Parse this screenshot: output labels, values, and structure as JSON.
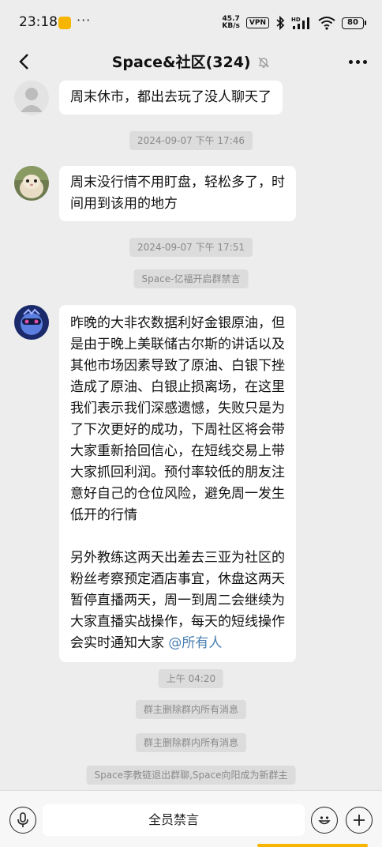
{
  "status_bar": {
    "time": "23:18",
    "dots": "···",
    "net_speed_value": "45.7",
    "net_speed_unit": "KB/s",
    "vpn": "VPN",
    "battery": "80"
  },
  "header": {
    "title": "Space&社区(324)"
  },
  "messages": [
    {
      "kind": "text",
      "avatar": "gray-default",
      "lines": [
        "周末休市，都出去玩了没人聊天了"
      ]
    },
    {
      "kind": "system",
      "text": "2024-09-07 下午 17:46"
    },
    {
      "kind": "text",
      "avatar": "hamster-photo",
      "lines": [
        "周末没行情不用盯盘，轻松多了，时",
        "间用到该用的地方"
      ]
    },
    {
      "kind": "system",
      "text": "2024-09-07 下午 17:51"
    },
    {
      "kind": "system",
      "text": "Space-亿福开启群禁言"
    },
    {
      "kind": "text",
      "avatar": "blue-character",
      "lines": [
        "昨晚的大非农数据利好金银原油，但",
        "是由于晚上美联储古尔斯的讲话以及",
        "其他市场因素导致了原油、白银下挫",
        "造成了原油、白银止损离场，在这里",
        "我们表示我们深感遗憾，失败只是为",
        "了下次更好的成功，下周社区将会带",
        "大家重新拾回信心，在短线交易上带",
        "大家抓回利润。预付率较低的朋友注",
        "意好自己的仓位风险，避免周一发生",
        "低开的行情",
        "",
        "另外教练这两天出差去三亚为社区的",
        "粉丝考察预定酒店事宜，休盘这两天",
        "暂停直播两天，周一到周二会继续为",
        "大家直播实战操作，每天的短线操作"
      ],
      "last_line": "会实时通知大家 ",
      "mention": "@所有人"
    },
    {
      "kind": "system",
      "text": "上午 04:20"
    },
    {
      "kind": "system",
      "text": "群主删除群内所有消息"
    },
    {
      "kind": "system",
      "text": "群主删除群内所有消息"
    },
    {
      "kind": "system",
      "text": "Space李教链退出群聊,Space向阳成为新群主"
    }
  ],
  "input_bar": {
    "muted_text": "全员禁言"
  },
  "icons": {
    "back": "chevron-left-icon",
    "mute": "bell-off-icon",
    "more": "more-dots-icon",
    "voice": "microphone-icon",
    "emoji": "emoji-icon",
    "add": "plus-icon"
  },
  "colors": {
    "background": "#ededed",
    "bubble": "#ffffff",
    "mention": "#4a7fb0",
    "system_chip": "#dcdcdc",
    "system_text": "#8a8a8a",
    "accent": "#f7b500"
  }
}
